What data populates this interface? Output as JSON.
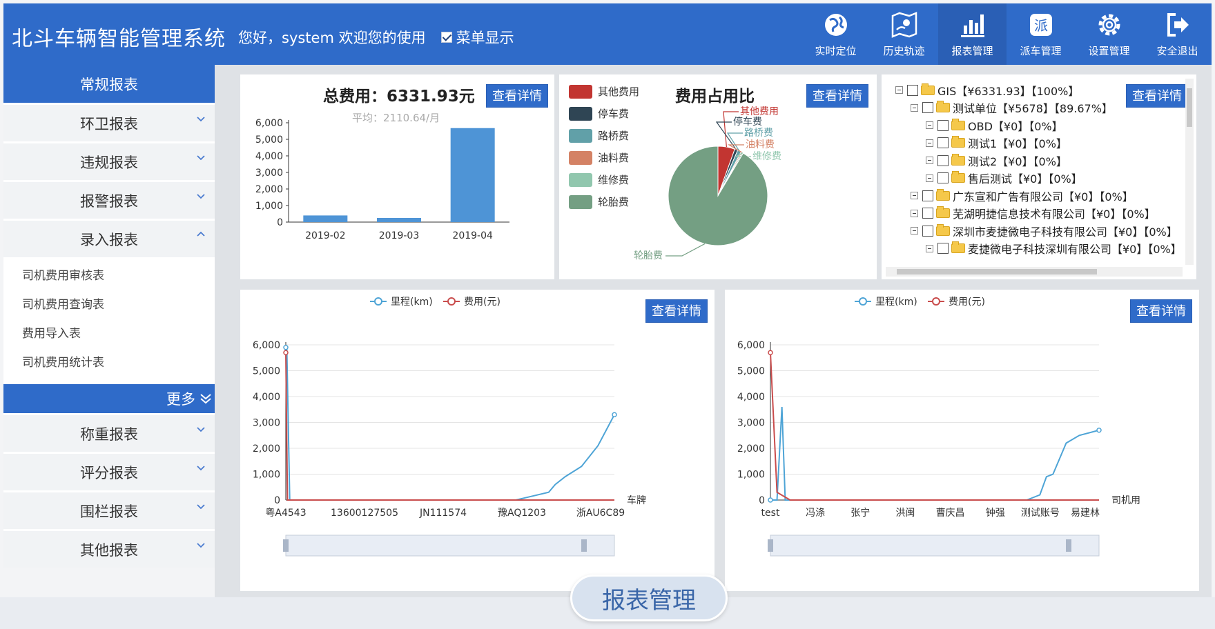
{
  "header": {
    "title": "北斗车辆智能管理系统",
    "greeting": "您好，system 欢迎您的使用",
    "menu_toggle_label": "菜单显示",
    "nav": [
      {
        "label": "实时定位",
        "icon": "globe-icon"
      },
      {
        "label": "历史轨迹",
        "icon": "map-track-icon"
      },
      {
        "label": "报表管理",
        "icon": "bar-chart-icon",
        "active": true
      },
      {
        "label": "派车管理",
        "icon": "dispatch-icon"
      },
      {
        "label": "设置管理",
        "icon": "gear-icon"
      },
      {
        "label": "安全退出",
        "icon": "logout-icon"
      }
    ]
  },
  "sidebar": {
    "head": "常规报表",
    "groups_top": [
      "环卫报表",
      "违规报表",
      "报警报表",
      "录入报表"
    ],
    "sub_items": [
      "司机费用审核表",
      "司机费用查询表",
      "费用导入表",
      "司机费用统计表"
    ],
    "more": "更多",
    "groups_bottom": [
      "称重报表",
      "评分报表",
      "围栏报表",
      "其他报表"
    ]
  },
  "detail_label": "查看详情",
  "total_panel": {
    "title": "总费用：6331.93元",
    "subtitle": "平均：2110.64/月"
  },
  "pie_panel": {
    "title": "费用占用比"
  },
  "tree": [
    {
      "level": 0,
      "text": "GIS【¥6331.93】【100%】"
    },
    {
      "level": 1,
      "text": "测试单位【¥5678】【89.67%】"
    },
    {
      "level": 2,
      "text": "OBD【¥0】【0%】"
    },
    {
      "level": 2,
      "text": "测试1【¥0】【0%】"
    },
    {
      "level": 2,
      "text": "测试2【¥0】【0%】"
    },
    {
      "level": 2,
      "text": "售后测试【¥0】【0%】"
    },
    {
      "level": 1,
      "text": "广东宣和广告有限公司【¥0】【0%】"
    },
    {
      "level": 1,
      "text": "芜湖明捷信息技术有限公司【¥0】【0%】"
    },
    {
      "level": 1,
      "text": "深圳市麦捷微电子科技有限公司【¥0】【0%】"
    },
    {
      "level": 2,
      "text": "麦捷微电子科技深圳有限公司【¥0】【0%】"
    }
  ],
  "chart_data": [
    {
      "type": "bar",
      "title": "总费用：6331.93元",
      "subtitle": "平均：2110.64/月",
      "categories": [
        "2019-02",
        "2019-03",
        "2019-04"
      ],
      "values": [
        400,
        250,
        5678
      ],
      "ylim": [
        0,
        6000
      ],
      "yticks": [
        "6,000",
        "5,000",
        "4,000",
        "3,000",
        "2,000",
        "1,000",
        "0"
      ],
      "color": "#4e94d6"
    },
    {
      "type": "pie",
      "title": "费用占用比",
      "slices": [
        {
          "name": "其他费用",
          "value": 5.5,
          "color": "#c23531"
        },
        {
          "name": "停车费",
          "value": 1.0,
          "color": "#2f4554"
        },
        {
          "name": "路桥费",
          "value": 1.2,
          "color": "#61a0a8"
        },
        {
          "name": "油料费",
          "value": 0.4,
          "color": "#d48265"
        },
        {
          "name": "维修费",
          "value": 0.4,
          "color": "#91c7ae"
        },
        {
          "name": "轮胎费",
          "value": 91.5,
          "color": "#749f83"
        }
      ]
    },
    {
      "type": "line",
      "legend": [
        "里程(km)",
        "费用(元)"
      ],
      "x_axis_name": "车牌",
      "x_tick_labels": [
        "粤A4543",
        "13600127505",
        "JN111574",
        "豫AQ1203",
        "浙AU6C89"
      ],
      "ylim": [
        0,
        6000
      ],
      "yticks": [
        "6,000",
        "5,000",
        "4,000",
        "3,000",
        "2,000",
        "1,000",
        "0"
      ],
      "series": [
        {
          "name": "里程(km)",
          "color": "#4ea4d6",
          "x": [
            0,
            0.3,
            1.2,
            70,
            80,
            82,
            85,
            90,
            95,
            100
          ],
          "y": [
            5900,
            5900,
            0,
            0,
            300,
            600,
            900,
            1300,
            2100,
            3300
          ]
        },
        {
          "name": "费用(元)",
          "color": "#c94c4c",
          "x": [
            0,
            0.5,
            100
          ],
          "y": [
            5700,
            0,
            0
          ]
        }
      ]
    },
    {
      "type": "line",
      "legend": [
        "里程(km)",
        "费用(元)"
      ],
      "x_axis_name": "司机用",
      "x_tick_labels": [
        "test",
        "冯涤",
        "张宁",
        "洪闽",
        "曹庆昌",
        "钟强",
        "测试账号",
        "易建林"
      ],
      "ylim": [
        0,
        6000
      ],
      "yticks": [
        "6,000",
        "5,000",
        "4,000",
        "3,000",
        "2,000",
        "1,000",
        "0"
      ],
      "series": [
        {
          "name": "里程(km)",
          "color": "#4ea4d6",
          "x": [
            0,
            2,
            3.5,
            4.5,
            6,
            78,
            82,
            84,
            86,
            88,
            90,
            94,
            100
          ],
          "y": [
            0,
            0,
            3600,
            0,
            0,
            0,
            200,
            900,
            1000,
            1600,
            2200,
            2500,
            2700
          ]
        },
        {
          "name": "费用(元)",
          "color": "#c94c4c",
          "x": [
            0,
            2,
            6,
            100
          ],
          "y": [
            5700,
            300,
            0,
            0
          ]
        }
      ]
    }
  ],
  "overlay_label": "报表管理"
}
